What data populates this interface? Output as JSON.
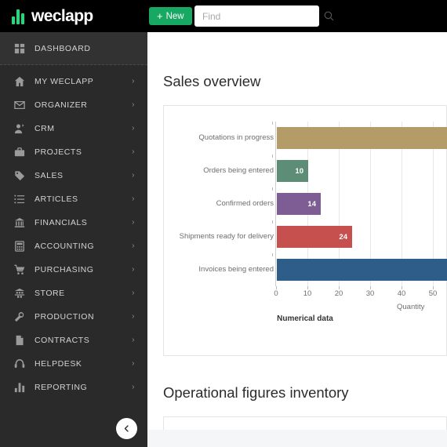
{
  "topbar": {
    "logo_text": "weclapp",
    "logo_icon": "weclapp-bars-logo",
    "new_button_label": "New",
    "new_button_plus": "+",
    "search_placeholder": "Find",
    "search_value": "",
    "search_icon": "search-icon",
    "accent_color": "#17a864",
    "logo_accent_color": "#1ddb7f"
  },
  "sidebar": {
    "collapse_icon": "chevron-left-icon",
    "items": [
      {
        "label": "DASHBOARD",
        "icon": "grid-icon",
        "chevron": false,
        "active": true
      },
      {
        "label": "MY WECLAPP",
        "icon": "home-icon",
        "chevron": true,
        "active": false
      },
      {
        "label": "ORGANIZER",
        "icon": "envelope-icon",
        "chevron": true,
        "active": false
      },
      {
        "label": "CRM",
        "icon": "user-icon",
        "chevron": true,
        "active": false
      },
      {
        "label": "PROJECTS",
        "icon": "briefcase-icon",
        "chevron": true,
        "active": false
      },
      {
        "label": "SALES",
        "icon": "tag-icon",
        "chevron": true,
        "active": false
      },
      {
        "label": "ARTICLES",
        "icon": "list-icon",
        "chevron": true,
        "active": false
      },
      {
        "label": "FINANCIALS",
        "icon": "bank-icon",
        "chevron": true,
        "active": false
      },
      {
        "label": "ACCOUNTING",
        "icon": "calculator-icon",
        "chevron": true,
        "active": false
      },
      {
        "label": "PURCHASING",
        "icon": "cart-icon",
        "chevron": true,
        "active": false
      },
      {
        "label": "STORE",
        "icon": "warehouse-icon",
        "chevron": true,
        "active": false
      },
      {
        "label": "PRODUCTION",
        "icon": "wrench-icon",
        "chevron": true,
        "active": false
      },
      {
        "label": "CONTRACTS",
        "icon": "document-icon",
        "chevron": true,
        "active": false
      },
      {
        "label": "HELPDESK",
        "icon": "headset-icon",
        "chevron": true,
        "active": false
      },
      {
        "label": "REPORTING",
        "icon": "barchart-icon",
        "chevron": true,
        "active": false
      }
    ],
    "chevron_glyph": "›"
  },
  "main": {
    "sections": [
      {
        "title": "Sales overview"
      },
      {
        "title": "Operational figures inventory"
      }
    ]
  },
  "chart_data": {
    "type": "bar",
    "orientation": "horizontal",
    "title": "",
    "legend_title": "Numerical data",
    "xlabel": "Quantity",
    "ylabel": "",
    "xlim": [
      0,
      57.5
    ],
    "xticks": [
      0,
      10,
      20,
      30,
      40,
      50
    ],
    "grid": true,
    "legend_position": "bottom",
    "categories": [
      "Quotations in progress",
      "Orders being entered",
      "Confirmed orders",
      "Shipments ready for delivery",
      "Invoices being entered"
    ],
    "values": [
      57,
      10,
      14,
      24,
      56
    ],
    "value_labels": [
      "",
      "10",
      "14",
      "24",
      ""
    ],
    "colors": [
      "#b39c68",
      "#5e8d77",
      "#7d5d93",
      "#c5504d",
      "#2e5d8a"
    ]
  }
}
